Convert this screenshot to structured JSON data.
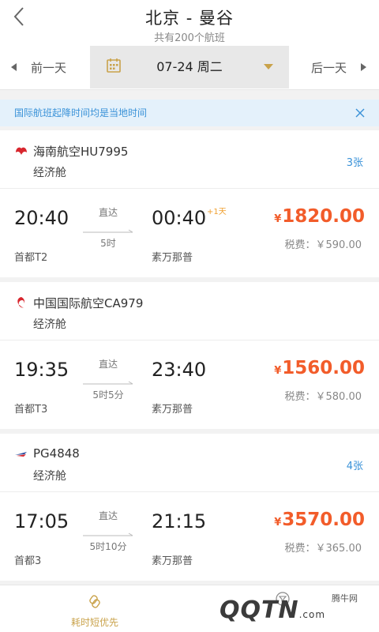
{
  "header": {
    "title": "北京 - 曼谷",
    "subtitle": "共有200个航班"
  },
  "datebar": {
    "prev_label": "前一天",
    "date": "07-24 周二",
    "next_label": "后一天"
  },
  "notice": {
    "text": "国际航班起降时间均是当地时间"
  },
  "flights": [
    {
      "airline": "海南航空HU7995",
      "cabin": "经济舱",
      "tickets": "3张",
      "dep_time": "20:40",
      "dep_airport": "首都T2",
      "type": "直达",
      "duration": "5时",
      "arr_time": "00:40",
      "plus_day": "+1天",
      "arr_airport": "素万那普",
      "currency": "¥",
      "price": "1820.00",
      "tax": "税费：￥590.00"
    },
    {
      "airline": "中国国际航空CA979",
      "cabin": "经济舱",
      "tickets": "",
      "dep_time": "19:35",
      "dep_airport": "首都T3",
      "type": "直达",
      "duration": "5时5分",
      "arr_time": "23:40",
      "plus_day": "",
      "arr_airport": "素万那普",
      "currency": "¥",
      "price": "1560.00",
      "tax": "税费：￥580.00"
    },
    {
      "airline": "PG4848",
      "cabin": "经济舱",
      "tickets": "4张",
      "dep_time": "17:05",
      "dep_airport": "首都3",
      "type": "直达",
      "duration": "5时10分",
      "arr_time": "21:15",
      "plus_day": "",
      "arr_airport": "素万那普",
      "currency": "¥",
      "price": "3570.00",
      "tax": "税费：￥365.00"
    }
  ],
  "bottom": {
    "sort_label": "耗时短优先",
    "watermark_text": "腾牛网",
    "watermark_logo": "QQTN",
    "watermark_domain": ".com"
  },
  "colors": {
    "price": "#f25c2a",
    "accent_gold": "#c9a24a",
    "link_blue": "#3a92d8"
  },
  "icons": {
    "back": "chevron-left-icon",
    "calendar": "calendar-icon",
    "close": "close-icon",
    "sort": "time-sort-icon",
    "filter": "filter-icon"
  }
}
